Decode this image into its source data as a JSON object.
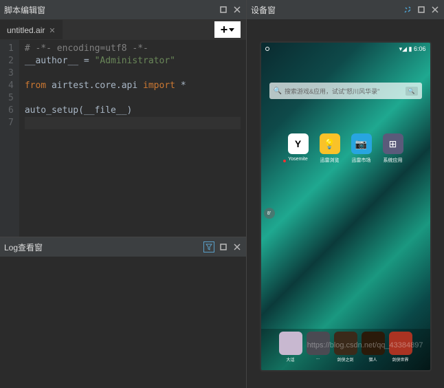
{
  "editor_panel": {
    "title": "脚本编辑窗",
    "tab_name": "untitled.air",
    "lines": [
      {
        "n": 1,
        "tokens": [
          [
            "cmt",
            "# -*- encoding=utf8 -*-"
          ]
        ]
      },
      {
        "n": 2,
        "tokens": [
          [
            "txt",
            "__author__ = "
          ],
          [
            "str",
            "\"Administrator\""
          ]
        ]
      },
      {
        "n": 3,
        "tokens": []
      },
      {
        "n": 4,
        "tokens": [
          [
            "kw",
            "from"
          ],
          [
            "txt",
            " airtest.core.api "
          ],
          [
            "kw",
            "import"
          ],
          [
            "txt",
            " *"
          ]
        ]
      },
      {
        "n": 5,
        "tokens": []
      },
      {
        "n": 6,
        "tokens": [
          [
            "txt",
            "auto_setup(__file__)"
          ]
        ]
      },
      {
        "n": 7,
        "tokens": [],
        "current": true
      }
    ]
  },
  "log_panel": {
    "title": "Log查看窗"
  },
  "device_panel": {
    "title": "设备窗",
    "status_time": "6:06",
    "search_icon": "🔍",
    "search_placeholder": "搜索游戏&应用，试试\"怒川风华录\"",
    "search_go": "🔍",
    "apps": [
      {
        "label": "Yosemite",
        "icon": "Y",
        "cls": "ic-white",
        "red_dot": true
      },
      {
        "label": "迅雷浏览",
        "icon": "💡",
        "cls": "ic-yellow"
      },
      {
        "label": "迅雷市场",
        "icon": "📷",
        "cls": "ic-cyan"
      },
      {
        "label": "系统应用",
        "icon": "⊞",
        "cls": "ic-gray"
      }
    ],
    "knob": "8'",
    "dock": [
      {
        "label": "大话",
        "color": "#c8b8d0"
      },
      {
        "label": "...",
        "color": "#4a4a52"
      },
      {
        "label": "剑侠之剑",
        "color": "#3a2a1a"
      },
      {
        "label": "猎人",
        "color": "#2a1a0a"
      },
      {
        "label": "剑侠世界",
        "color": "#aa3322"
      }
    ]
  },
  "watermark": "https://blog.csdn.net/qq_43384897"
}
